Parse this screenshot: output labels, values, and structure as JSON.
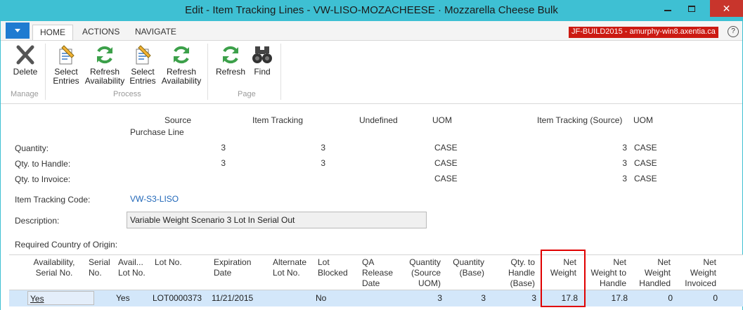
{
  "window": {
    "title": "Edit - Item Tracking Lines - VW-LISO-MOZACHEESE · Mozzarella Cheese Bulk",
    "close_glyph": "✕",
    "help_glyph": "?"
  },
  "ribbon": {
    "tabs": [
      "HOME",
      "ACTIONS",
      "NAVIGATE"
    ],
    "server": "JF-BUILD2015 - amurphy-win8.axentia.ca",
    "buttons": {
      "delete": [
        "Delete"
      ],
      "select1": [
        "Select",
        "Entries"
      ],
      "refresh1": [
        "Refresh",
        "Availability"
      ],
      "select2": [
        "Select",
        "Entries"
      ],
      "refresh2": [
        "Refresh",
        "Availability"
      ],
      "refresh": [
        "Refresh"
      ],
      "find": [
        "Find"
      ]
    },
    "groups": [
      "Manage",
      "Process",
      "Page"
    ]
  },
  "header": {
    "col_source": "Source",
    "col_source_sub": "Purchase Line",
    "col_item_tracking": "Item Tracking",
    "col_undefined": "Undefined",
    "col_uom": "UOM",
    "col_item_tracking_source": "Item Tracking (Source)",
    "col_uom2": "UOM",
    "rows": [
      {
        "label": "Quantity:",
        "source": "3",
        "tracking": "3",
        "uom": "CASE",
        "tracking_source": "3",
        "uom2": "CASE"
      },
      {
        "label": "Qty. to Handle:",
        "source": "3",
        "tracking": "3",
        "uom": "CASE",
        "tracking_source": "3",
        "uom2": "CASE"
      },
      {
        "label": "Qty. to Invoice:",
        "source": "",
        "tracking": "",
        "uom": "CASE",
        "tracking_source": "3",
        "uom2": "CASE"
      }
    ],
    "item_tracking_code_label": "Item Tracking Code:",
    "item_tracking_code": "VW-S3-LISO",
    "description_label": "Description:",
    "description": "Variable Weight Scenario 3 Lot In Serial Out",
    "country_label": "Required Country of Origin:"
  },
  "grid": {
    "columns": [
      [
        "Availability,",
        "Serial No."
      ],
      [
        "Serial",
        "No."
      ],
      [
        "Avail...",
        "Lot No."
      ],
      [
        "Lot No."
      ],
      [
        "Expiration",
        "Date"
      ],
      [
        "Alternate",
        "Lot No."
      ],
      [
        "Lot",
        "Blocked"
      ],
      [
        "QA",
        "Release",
        "Date"
      ],
      [
        "Quantity",
        "(Source",
        "UOM)"
      ],
      [
        "Quantity",
        "(Base)"
      ],
      [
        "Qty. to",
        "Handle",
        "(Base)"
      ],
      [
        "Net",
        "Weight"
      ],
      [
        "Net",
        "Weight to",
        "Handle"
      ],
      [
        "Net",
        "Weight",
        "Handled"
      ],
      [
        "Net",
        "Weight",
        "Invoiced"
      ]
    ],
    "row": {
      "availability_serial": "Yes",
      "serial_no": "",
      "avail_lot": "Yes",
      "lot_no": "LOT0000373",
      "expiration": "11/21/2015",
      "alternate_lot": "",
      "lot_blocked": "No",
      "qa_release": "",
      "qty_source_uom": "3",
      "qty_base": "3",
      "qty_to_handle_base": "3",
      "net_weight": "17.8",
      "net_weight_to_handle": "17.8",
      "net_weight_handled": "0",
      "net_weight_invoiced": "0"
    }
  },
  "colors": {
    "titlebar": "#3ec0d3",
    "accent_blue": "#1f7bd1",
    "server_badge": "#cc1a12",
    "selected_row": "#d3e7fa",
    "highlight_box": "#e00000"
  }
}
